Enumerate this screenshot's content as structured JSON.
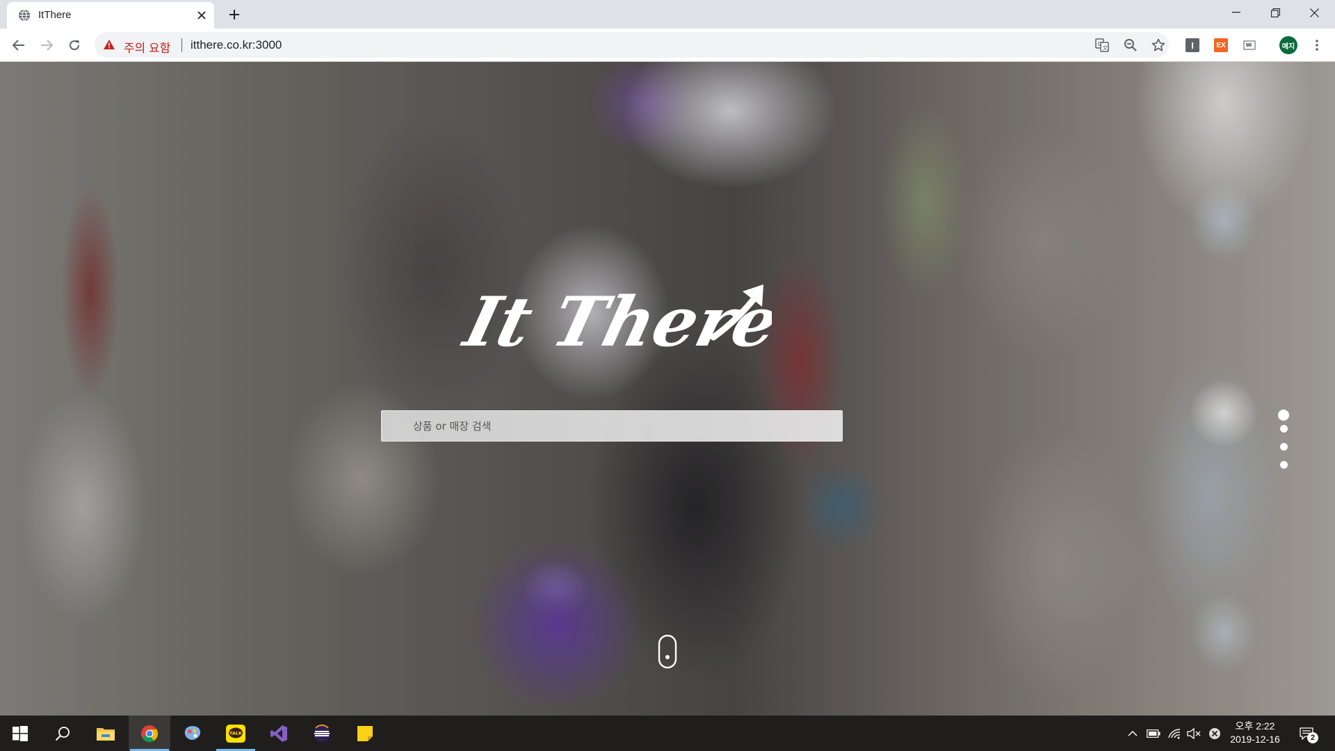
{
  "browser": {
    "tab": {
      "title": "ItThere"
    },
    "omnibox": {
      "warning": "주의 요함",
      "url": "itthere.co.kr:3000"
    },
    "profile": {
      "avatar_text": "예지"
    },
    "extensions": {
      "i_label": "I",
      "ex_label": "EX"
    }
  },
  "page": {
    "logo_text": "It There",
    "search": {
      "placeholder": "상품 or 매장 검색",
      "value": ""
    },
    "pagination": {
      "count": 4,
      "active_index": 0
    }
  },
  "taskbar": {
    "apps": [
      {
        "name": "file-explorer",
        "active": false
      },
      {
        "name": "chrome",
        "active": true
      },
      {
        "name": "paint-3d",
        "active": false
      },
      {
        "name": "kakaotalk",
        "active": false,
        "label": "TALK"
      },
      {
        "name": "visual-studio",
        "active": false
      },
      {
        "name": "eclipse",
        "active": false
      },
      {
        "name": "sticky-notes",
        "active": false
      }
    ],
    "clock": {
      "period_time": "오후 2:22",
      "date": "2019-12-16"
    },
    "notifications": {
      "count": "2"
    }
  },
  "colors": {
    "omnibox_warning": "#c5221f",
    "avatar_bg": "#0b6b3a",
    "ex_extension": "#f26522",
    "taskbar_bg": "#1f1e1d",
    "kakao_yellow": "#fae100"
  }
}
